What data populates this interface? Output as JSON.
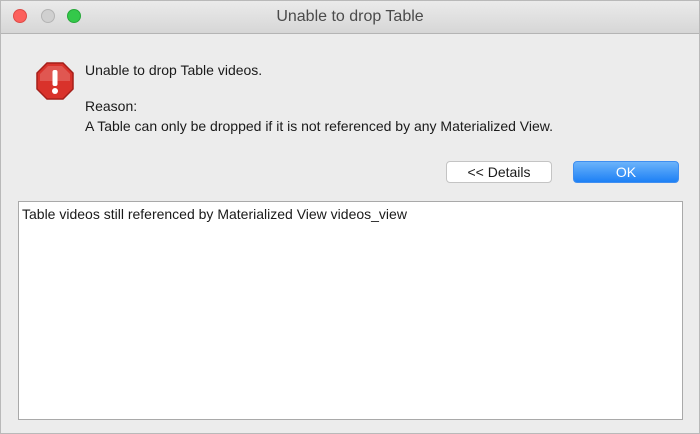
{
  "window": {
    "title": "Unable to drop Table"
  },
  "dialog": {
    "message": "Unable to drop Table videos.",
    "reason_label": "Reason:",
    "reason_text": "A Table can only be dropped if it is not referenced by any Materialized View.",
    "icon": "alert-stop-icon"
  },
  "buttons": {
    "details_label": "<< Details",
    "ok_label": "OK"
  },
  "details": {
    "text": "Table videos still referenced by Materialized View videos_view"
  },
  "colors": {
    "ok_button": "#1d80f5",
    "close_button": "#fc605c",
    "maximize_button": "#34c84a",
    "alert_icon": "#d9322b"
  }
}
